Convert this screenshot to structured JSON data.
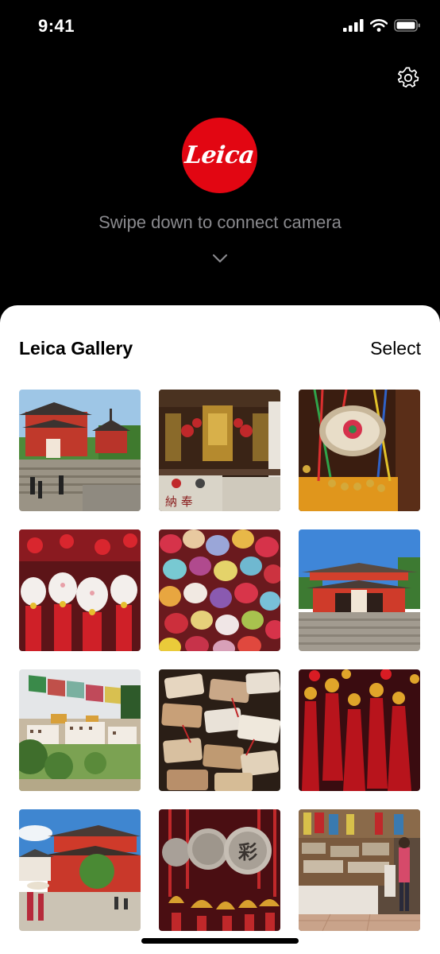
{
  "status_bar": {
    "time": "9:41"
  },
  "connect": {
    "logo_text": "Leica",
    "prompt": "Swipe down to connect camera"
  },
  "gallery": {
    "title": "Leica Gallery",
    "select_label": "Select"
  },
  "colors": {
    "leica_red": "#e20612",
    "prompt_gray": "#8a8a8e"
  },
  "photos": [
    {
      "subject": "temple-gate-stairs"
    },
    {
      "subject": "shrine-interior"
    },
    {
      "subject": "colorful-tassel-charm"
    },
    {
      "subject": "lucky-cat-charms"
    },
    {
      "subject": "colorful-wish-stones"
    },
    {
      "subject": "red-temple-gate"
    },
    {
      "subject": "prayer-flags-monastery"
    },
    {
      "subject": "wishing-plaques"
    },
    {
      "subject": "red-tassels"
    },
    {
      "subject": "temple-visitors"
    },
    {
      "subject": "bells-and-coins"
    },
    {
      "subject": "market-stall"
    }
  ]
}
